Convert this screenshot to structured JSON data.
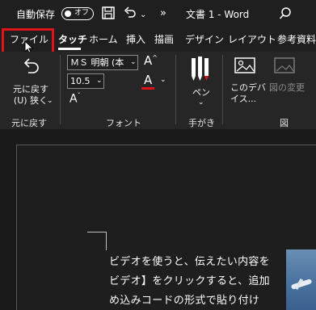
{
  "titlebar": {
    "autosave_label": "自動保存",
    "autosave_state": "オフ",
    "more_label": "»",
    "document_title": "文書 1 - Word"
  },
  "tabs": [
    {
      "label": "ファイル"
    },
    {
      "label": "タッチ"
    },
    {
      "label": "ホーム"
    },
    {
      "label": "挿入"
    },
    {
      "label": "描画"
    },
    {
      "label": "デザイン"
    },
    {
      "label": "レイアウト"
    },
    {
      "label": "参考資料"
    }
  ],
  "ribbon": {
    "undo": {
      "label_line1": "元に戻す",
      "label_line2": "(U) 狭く"
    },
    "groups": {
      "undo": "元に戻す",
      "font": "フォント",
      "ink": "手がき",
      "figure": "図"
    },
    "font": {
      "font_name": "ＭＳ 明朝 (本",
      "font_size": "10.5",
      "font_color_glyph": "A"
    },
    "pen": {
      "label": "ペン"
    },
    "device": {
      "label_line1": "このデバ",
      "label_line2": "イス..."
    },
    "picture_change": {
      "label": "図の変更"
    }
  },
  "document": {
    "lines": [
      "ビデオを使うと、伝えたい内容を",
      "ビデオ】をクリックすると、追加",
      "め込みコードの形式で貼り付け"
    ]
  },
  "colors": {
    "highlight_border": "#e0131a",
    "font_color_underline": "#e0131a"
  }
}
